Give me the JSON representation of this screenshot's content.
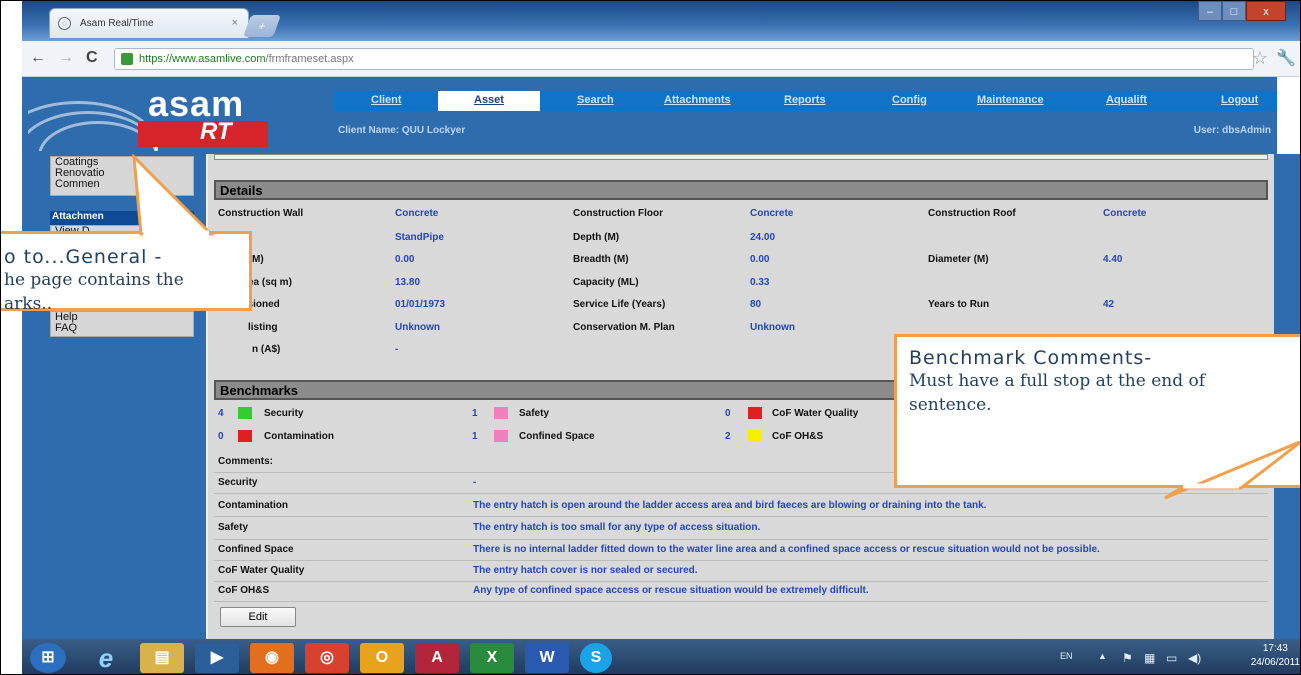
{
  "browser": {
    "tab_title": "Asam Real/Time",
    "tab_close": "×",
    "new_tab": "+",
    "url_host": "https://www.asamlive.com",
    "url_path": "/frmframeset.aspx",
    "back_glyph": "←",
    "forward_glyph": "→",
    "reload_glyph": "C",
    "star_glyph": "☆",
    "wrench_glyph": "🔧",
    "win_min": "–",
    "win_max": "□",
    "win_close": "x"
  },
  "app": {
    "logo_text": "asam",
    "logo_sub": "RT",
    "client_name": "Client Name: QUU Lockyer",
    "user": "User: dbsAdmin",
    "nav": [
      "Client",
      "Asset",
      "Search",
      "Attachments",
      "Reports",
      "Config",
      "Maintenance",
      "Aqualift",
      "Logout"
    ],
    "active_nav": "Asset"
  },
  "sidebar": {
    "top_items": [
      "Coatings",
      "Renovatio",
      "Commen"
    ],
    "section": "Attachmen",
    "section_item": "View D",
    "bottom_items": [
      "Help",
      "FAQ"
    ]
  },
  "details": {
    "heading": "Details",
    "col1": [
      {
        "label": "Construction Wall",
        "value": "Concrete"
      },
      {
        "label": "",
        "value": "StandPipe"
      },
      {
        "label": "M)",
        "value": "0.00"
      },
      {
        "label": "ea (sq m)",
        "value": "13.80"
      },
      {
        "label": "ssioned",
        "value": "01/01/1973"
      },
      {
        "label": "listing",
        "value": "Unknown"
      },
      {
        "label": "n (A$)",
        "value": "-"
      }
    ],
    "col2": [
      {
        "label": "Construction Floor",
        "value": "Concrete"
      },
      {
        "label": "Depth (M)",
        "value": "24.00"
      },
      {
        "label": "Breadth (M)",
        "value": "0.00"
      },
      {
        "label": "Capacity (ML)",
        "value": "0.33"
      },
      {
        "label": "Service Life (Years)",
        "value": "80"
      },
      {
        "label": "Conservation M. Plan",
        "value": "Unknown"
      }
    ],
    "col3": [
      {
        "label": "Construction Roof",
        "value": "Concrete"
      },
      {
        "label": "",
        "value": ""
      },
      {
        "label": "Diameter (M)",
        "value": "4.40"
      },
      {
        "label": "",
        "value": ""
      },
      {
        "label": "Years to Run",
        "value": "42"
      }
    ]
  },
  "benchmarks": {
    "heading": "Benchmarks",
    "items": [
      {
        "count": "4",
        "color": "#33cc33",
        "label": "Security"
      },
      {
        "count": "1",
        "color": "#f07fbe",
        "label": "Safety"
      },
      {
        "count": "0",
        "color": "#e02020",
        "label": "CoF Water Quality"
      },
      {
        "count": "0",
        "color": "#e02020",
        "label": "Contamination"
      },
      {
        "count": "1",
        "color": "#f07fbe",
        "label": "Confined Space"
      },
      {
        "count": "2",
        "color": "#f5f000",
        "label": "CoF OH&S"
      }
    ],
    "comments_label": "Comments:",
    "comments": [
      {
        "label": "Security",
        "text": "-"
      },
      {
        "label": "Contamination",
        "text": "The entry hatch is open around the ladder access area and bird faeces are blowing or draining into the tank."
      },
      {
        "label": "Safety",
        "text": "The entry hatch is too small for any type of access situation."
      },
      {
        "label": "Confined Space",
        "text": "There is no internal ladder fitted down to the water line area and a confined space access or rescue situation would not be possible."
      },
      {
        "label": "CoF Water Quality",
        "text": "The entry hatch cover is nor sealed or secured."
      },
      {
        "label": "CoF OH&S",
        "text": "Any type of confined space access or rescue situation would be extremely difficult."
      }
    ],
    "edit_label": "Edit"
  },
  "callouts": {
    "left_lines": [
      "o to...General -",
      "he page contains the",
      "arks.."
    ],
    "right_title": "Benchmark Comments-",
    "right_lines": [
      "Must have a full stop at the end of",
      "sentence."
    ]
  },
  "taskbar": {
    "tray_lang": "EN",
    "tray_up": "▲",
    "time": "17:43",
    "date": "24/06/2011",
    "apps": [
      {
        "name": "start",
        "glyph": "⊞",
        "color": "#2a6fc0"
      },
      {
        "name": "ie",
        "glyph": "e",
        "color": "#1d7fd6"
      },
      {
        "name": "explorer",
        "glyph": "▤",
        "color": "#d8b24a"
      },
      {
        "name": "media",
        "glyph": "▶",
        "color": "#2c5f9a"
      },
      {
        "name": "firefox",
        "glyph": "◉",
        "color": "#e36f1e"
      },
      {
        "name": "chrome",
        "glyph": "◎",
        "color": "#d8402f"
      },
      {
        "name": "outlook",
        "glyph": "O",
        "color": "#e8a21c"
      },
      {
        "name": "access",
        "glyph": "A",
        "color": "#b3253a"
      },
      {
        "name": "excel",
        "glyph": "X",
        "color": "#2a8a3e"
      },
      {
        "name": "word",
        "glyph": "W",
        "color": "#2a5ab0"
      },
      {
        "name": "skype",
        "glyph": "S",
        "color": "#1aa3e6"
      }
    ]
  }
}
